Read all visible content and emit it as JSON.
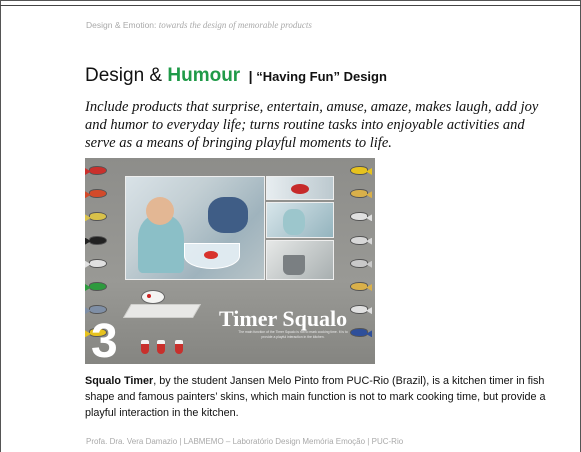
{
  "header": {
    "prefix": "Design & Emotion: ",
    "subtitle": "towards the design of memorable products"
  },
  "title": {
    "part_a": "Design & ",
    "part_b": "Humour",
    "separator": "|",
    "part_c": " “Having Fun” Design",
    "accent_color": "#1f9a48"
  },
  "intro": "Include products that surprise, entertain, amuse, amaze, makes laugh, add joy and humor to everyday life; turns routine tasks into enjoyable activities and serve as a means of bringing playful moments to life.",
  "figure": {
    "title": "Timer Squalo",
    "number": "3",
    "caption": "The main function of the Timer Squalo is not to mark cooking time. It is to provide a playful interaction in the kitchen.",
    "left_fish_colors": [
      "#c9302c",
      "#d24a2a",
      "#d8c14a",
      "#222222",
      "#e0e0e0",
      "#2e9a3e",
      "#7f8fa6",
      "#e6c21e"
    ],
    "right_fish_colors": [
      "#e6c21e",
      "#d9b04a",
      "#e0e0e0",
      "#d8d8d8",
      "#c9c9c9",
      "#d9b04a",
      "#e0e0e0",
      "#2e4f9a"
    ]
  },
  "body": {
    "lead": "Squalo Timer",
    "text": ", by the student Jansen Melo Pinto from PUC-Rio (Brazil), is a kitchen timer in fish shape and  famous painters’ skins, which main function is not to mark cooking time, but provide a playful interaction in the kitchen."
  },
  "footer": "Profa. Dra. Vera Damazio | LABMEMO – Laboratório Design Memória Emoção | PUC-Rio"
}
